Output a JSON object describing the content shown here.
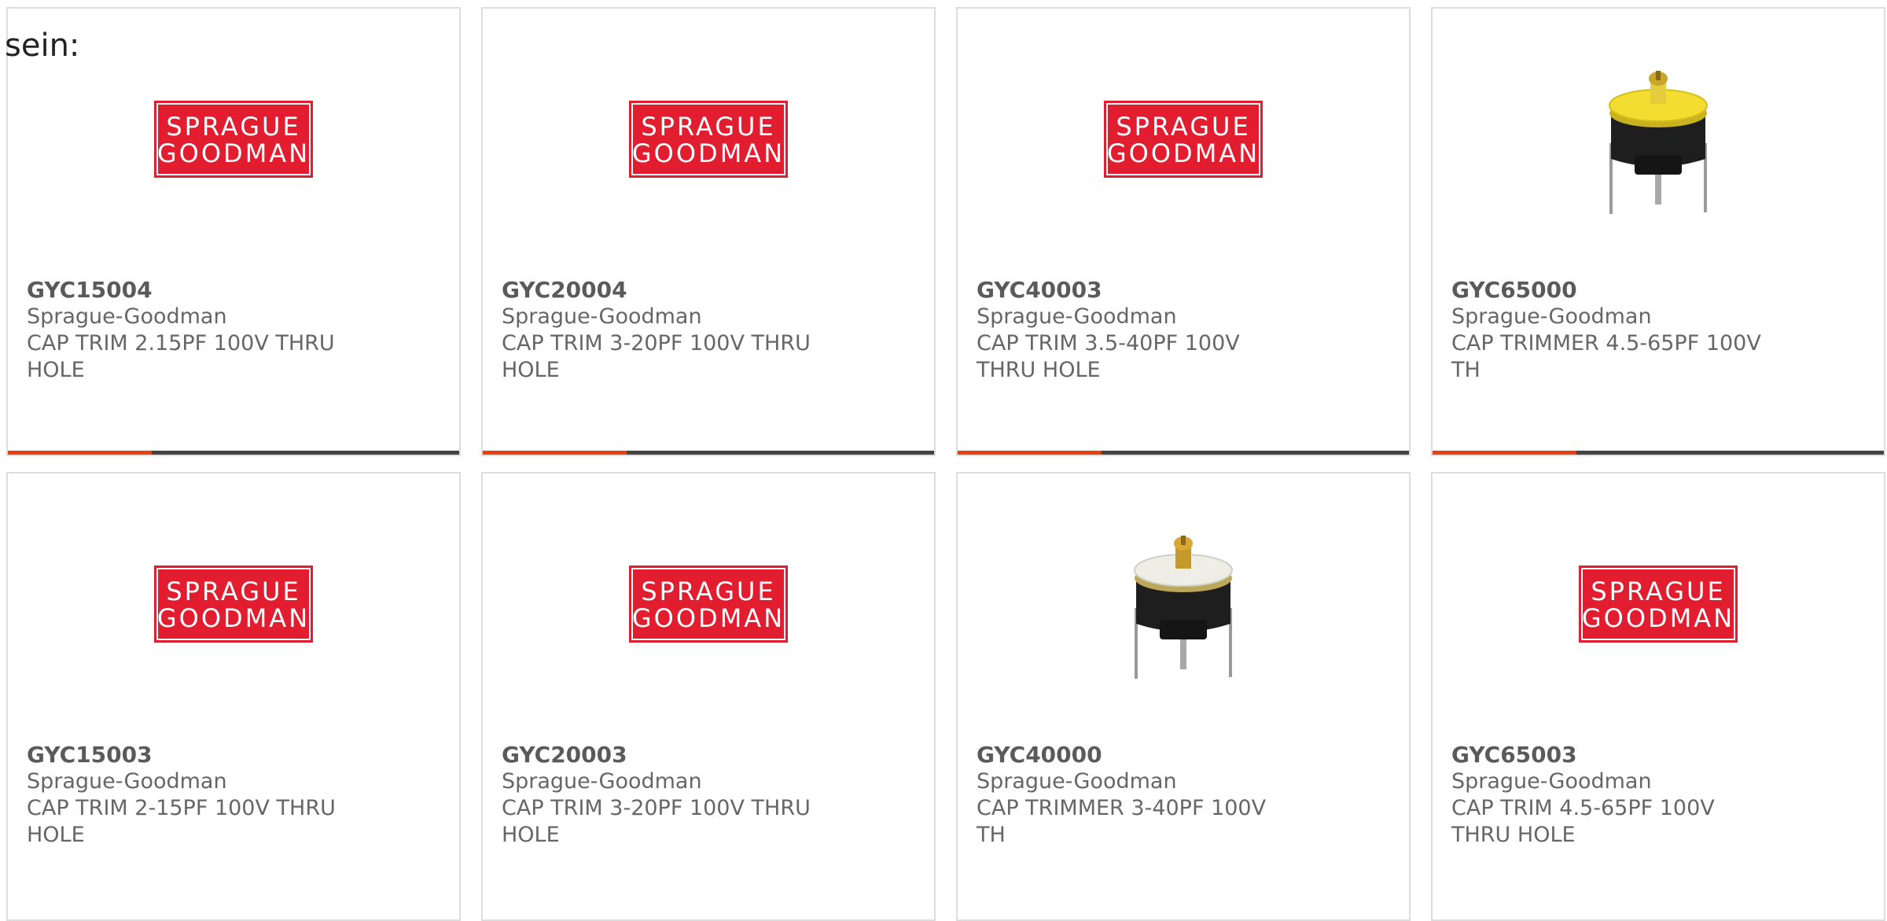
{
  "intro_text": "sein:",
  "accent_color": "#e8410f",
  "progress_track_color": "#444444",
  "products": [
    {
      "part_number": "GYC15004",
      "manufacturer": "Sprague-Goodman",
      "description": "CAP TRIM 2.15PF 100V THRU HOLE",
      "image": "sprague-goodman-logo",
      "logo_text": [
        "SPRAGUE",
        "GOODMAN"
      ],
      "progress": 0.32
    },
    {
      "part_number": "GYC20004",
      "manufacturer": "Sprague-Goodman",
      "description": "CAP TRIM 3-20PF 100V THRU HOLE",
      "image": "sprague-goodman-logo",
      "logo_text": [
        "SPRAGUE",
        "GOODMAN"
      ],
      "progress": 0.32
    },
    {
      "part_number": "GYC40003",
      "manufacturer": "Sprague-Goodman",
      "description": "CAP TRIM 3.5-40PF 100V THRU HOLE",
      "image": "sprague-goodman-logo",
      "logo_text": [
        "SPRAGUE",
        "GOODMAN"
      ],
      "progress": 0.32
    },
    {
      "part_number": "GYC65000",
      "manufacturer": "Sprague-Goodman",
      "description": "CAP TRIMMER 4.5-65PF 100V TH",
      "image": "yellow-trimmer-capacitor-photo",
      "progress": 0.32
    },
    {
      "part_number": "GYC15003",
      "manufacturer": "Sprague-Goodman",
      "description": "CAP TRIM 2-15PF 100V THRU HOLE",
      "image": "sprague-goodman-logo",
      "logo_text": [
        "SPRAGUE",
        "GOODMAN"
      ]
    },
    {
      "part_number": "GYC20003",
      "manufacturer": "Sprague-Goodman",
      "description": "CAP TRIM 3-20PF 100V THRU HOLE",
      "image": "sprague-goodman-logo",
      "logo_text": [
        "SPRAGUE",
        "GOODMAN"
      ]
    },
    {
      "part_number": "GYC40000",
      "manufacturer": "Sprague-Goodman",
      "description": "CAP TRIMMER 3-40PF 100V TH",
      "image": "white-trimmer-capacitor-photo"
    },
    {
      "part_number": "GYC65003",
      "manufacturer": "Sprague-Goodman",
      "description": "CAP TRIM 4.5-65PF 100V THRU HOLE",
      "image": "sprague-goodman-logo",
      "logo_text": [
        "SPRAGUE",
        "GOODMAN"
      ]
    }
  ]
}
